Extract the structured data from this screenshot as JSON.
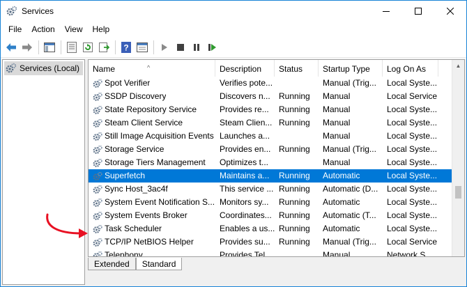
{
  "window": {
    "title": "Services",
    "icon": "services-gear-icon",
    "controls": {
      "minimize": "minimize-icon",
      "maximize": "maximize-icon",
      "close": "close-icon"
    }
  },
  "menu": [
    "File",
    "Action",
    "View",
    "Help"
  ],
  "toolbar": {
    "buttons": [
      "back-arrow-icon",
      "forward-arrow-icon",
      "console-tree-icon",
      "properties-icon",
      "refresh-icon",
      "export-list-icon",
      "help-icon",
      "view-icon",
      "start-icon",
      "stop-icon",
      "pause-icon",
      "restart-icon"
    ]
  },
  "left_pane": {
    "tree_item": "Services (Local)"
  },
  "table": {
    "columns": [
      "Name",
      "Description",
      "Status",
      "Startup Type",
      "Log On As"
    ],
    "rows": [
      {
        "name": "Spot Verifier",
        "description": "Verifies pote...",
        "status": "",
        "startup": "Manual (Trig...",
        "logon": "Local Syste..."
      },
      {
        "name": "SSDP Discovery",
        "description": "Discovers n...",
        "status": "Running",
        "startup": "Manual",
        "logon": "Local Service"
      },
      {
        "name": "State Repository Service",
        "description": "Provides re...",
        "status": "Running",
        "startup": "Manual",
        "logon": "Local Syste..."
      },
      {
        "name": "Steam Client Service",
        "description": "Steam Clien...",
        "status": "Running",
        "startup": "Manual",
        "logon": "Local Syste..."
      },
      {
        "name": "Still Image Acquisition Events",
        "description": "Launches a...",
        "status": "",
        "startup": "Manual",
        "logon": "Local Syste..."
      },
      {
        "name": "Storage Service",
        "description": "Provides en...",
        "status": "Running",
        "startup": "Manual (Trig...",
        "logon": "Local Syste..."
      },
      {
        "name": "Storage Tiers Management",
        "description": "Optimizes t...",
        "status": "",
        "startup": "Manual",
        "logon": "Local Syste..."
      },
      {
        "name": "Superfetch",
        "description": "Maintains a...",
        "status": "Running",
        "startup": "Automatic",
        "logon": "Local Syste..."
      },
      {
        "name": "Sync Host_3ac4f",
        "description": "This service ...",
        "status": "Running",
        "startup": "Automatic (D...",
        "logon": "Local Syste..."
      },
      {
        "name": "System Event Notification S...",
        "description": "Monitors sy...",
        "status": "Running",
        "startup": "Automatic",
        "logon": "Local Syste..."
      },
      {
        "name": "System Events Broker",
        "description": "Coordinates...",
        "status": "Running",
        "startup": "Automatic (T...",
        "logon": "Local Syste..."
      },
      {
        "name": "Task Scheduler",
        "description": "Enables a us...",
        "status": "Running",
        "startup": "Automatic",
        "logon": "Local Syste..."
      },
      {
        "name": "TCP/IP NetBIOS Helper",
        "description": "Provides su...",
        "status": "Running",
        "startup": "Manual (Trig...",
        "logon": "Local Service"
      },
      {
        "name": "Telephony",
        "description": "Provides Tel...",
        "status": "",
        "startup": "Manual",
        "logon": "Network S..."
      }
    ],
    "selected_row": "Superfetch"
  },
  "tabs": [
    "Extended",
    "Standard"
  ],
  "active_tab": "Standard",
  "colors": {
    "selection": "#0078d7",
    "annotation_arrow": "#e81123",
    "window_border": "#1883d7"
  }
}
